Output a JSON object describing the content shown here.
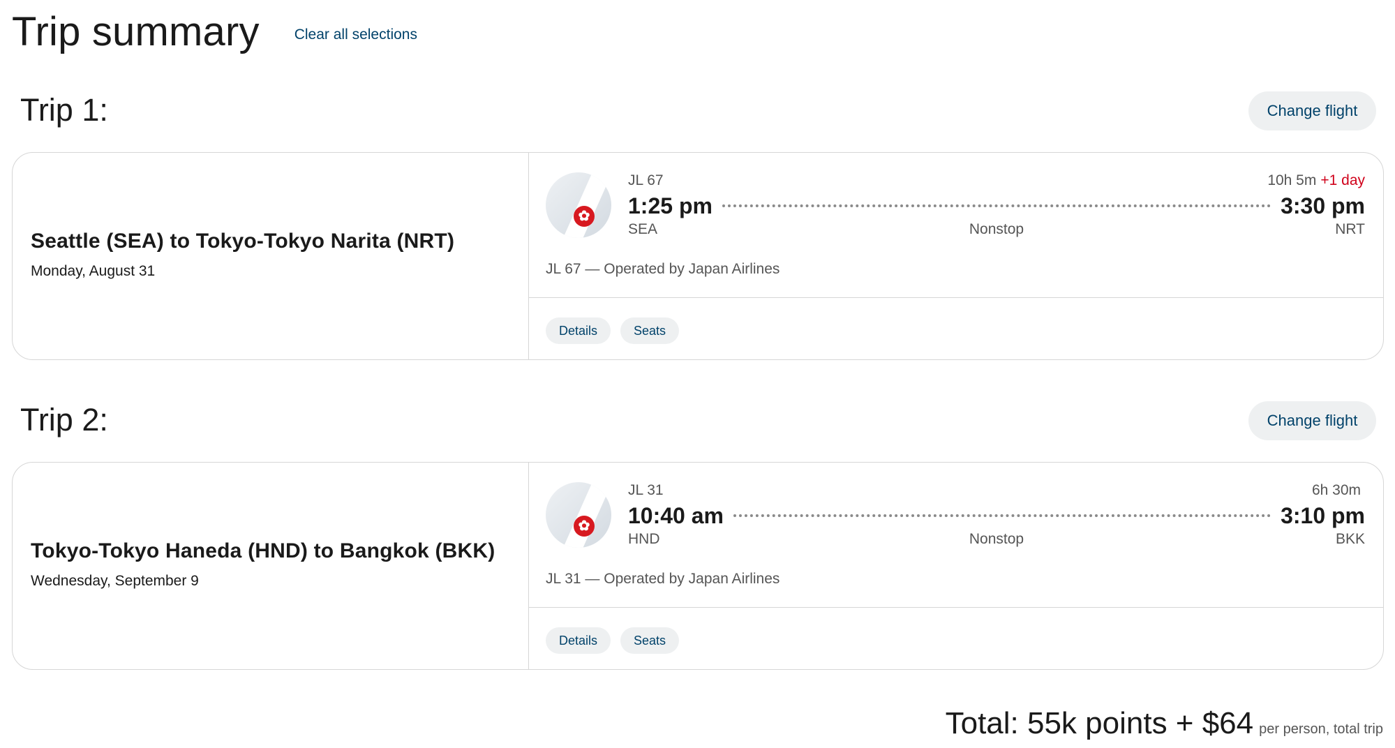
{
  "header": {
    "title": "Trip summary",
    "clear_label": "Clear all selections"
  },
  "trips": [
    {
      "title": "Trip 1:",
      "change_label": "Change flight",
      "route": "Seattle (SEA) to Tokyo-Tokyo Narita (NRT)",
      "date": "Monday, August 31",
      "flight": {
        "number": "JL 67",
        "duration": "10h 5m",
        "plus_day": "+1 day",
        "depart_time": "1:25 pm",
        "arrive_time": "3:30 pm",
        "origin": "SEA",
        "destination": "NRT",
        "stops": "Nonstop",
        "operated_by": "JL 67 — Operated by Japan Airlines"
      },
      "details_label": "Details",
      "seats_label": "Seats"
    },
    {
      "title": "Trip 2:",
      "change_label": "Change flight",
      "route": "Tokyo-Tokyo Haneda (HND) to Bangkok (BKK)",
      "date": "Wednesday, September 9",
      "flight": {
        "number": "JL 31",
        "duration": "6h 30m",
        "plus_day": "",
        "depart_time": "10:40 am",
        "arrive_time": "3:10 pm",
        "origin": "HND",
        "destination": "BKK",
        "stops": "Nonstop",
        "operated_by": "JL 31 — Operated by Japan Airlines"
      },
      "details_label": "Details",
      "seats_label": "Seats"
    }
  ],
  "total": {
    "main": "Total: 55k points + $64",
    "note": "per person, total trip"
  },
  "colors": {
    "link": "#01426a",
    "plus_day": "#d0021b",
    "airline_logo": "#d71920"
  },
  "icons": {
    "airline_logo": "japan-airlines-crane-logo-icon"
  }
}
